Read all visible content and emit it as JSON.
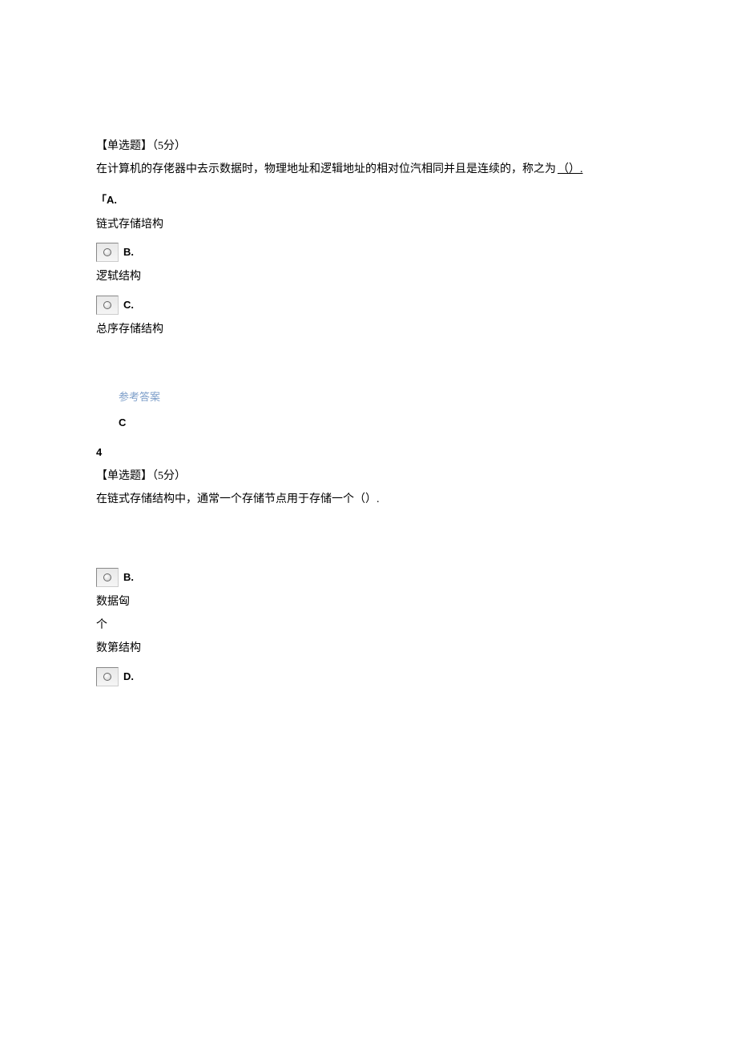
{
  "q3": {
    "header": "【单选题】（5分）",
    "text_prefix": "在计算机的存佬器中去示数据时，物理地址和逻辑地址的相对位汽相同并且是连续的，称之为",
    "blank": "（）.",
    "options": {
      "A": {
        "label": "A.",
        "text": "链式存储培构"
      },
      "B": {
        "label": "B.",
        "text": "逻轼结构"
      },
      "C": {
        "label": "C.",
        "text": "总序存储结构"
      }
    },
    "answer_label": "参考答案",
    "answer_value": "C"
  },
  "q4": {
    "number": "4",
    "header": "【单选题】（5分）",
    "text": "在链式存储结构中，通常一个存储节点用于存储一个（）.",
    "options": {
      "B": {
        "label": "B.",
        "line1": "数据匈",
        "line2": "个",
        "line3": "数第结构"
      },
      "D": {
        "label": "D."
      }
    }
  }
}
